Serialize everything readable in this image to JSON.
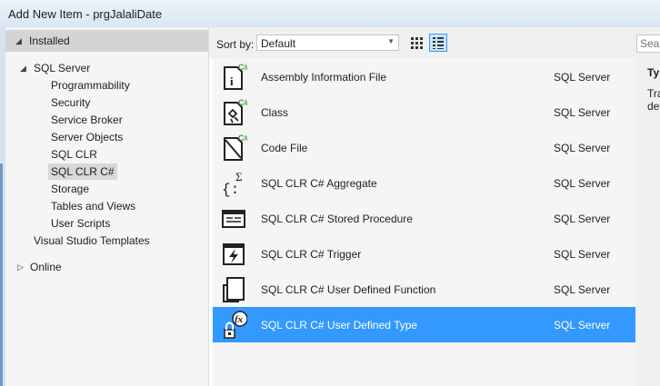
{
  "window": {
    "title": "Add New Item - prgJalaliDate"
  },
  "left_pane": {
    "installed_label": "Installed",
    "tree": {
      "sql_server": "SQL Server",
      "children": [
        "Programmability",
        "Security",
        "Service Broker",
        "Server Objects",
        "SQL CLR",
        "SQL CLR C#",
        "Storage",
        "Tables and Views",
        "User Scripts"
      ],
      "selected_child": "SQL CLR C#",
      "vs_templates": "Visual Studio Templates",
      "online": "Online"
    }
  },
  "sort_bar": {
    "label": "Sort by:",
    "selected": "Default"
  },
  "items": [
    {
      "name": "Assembly Information File",
      "category": "SQL Server",
      "icon": "assembly-info-icon"
    },
    {
      "name": "Class",
      "category": "SQL Server",
      "icon": "class-icon"
    },
    {
      "name": "Code File",
      "category": "SQL Server",
      "icon": "code-file-icon"
    },
    {
      "name": "SQL CLR C# Aggregate",
      "category": "SQL Server",
      "icon": "aggregate-icon"
    },
    {
      "name": "SQL CLR C# Stored Procedure",
      "category": "SQL Server",
      "icon": "stored-procedure-icon"
    },
    {
      "name": "SQL CLR C# Trigger",
      "category": "SQL Server",
      "icon": "trigger-icon"
    },
    {
      "name": "SQL CLR C# User Defined Function",
      "category": "SQL Server",
      "icon": "user-defined-function-icon"
    },
    {
      "name": "SQL CLR C# User Defined Type",
      "category": "SQL Server",
      "icon": "user-defined-type-icon",
      "selected": true
    }
  ],
  "right_pane": {
    "search_placeholder": "Search Installed Templates",
    "type_heading": "Type:",
    "description": [
      "Tra",
      "def"
    ]
  },
  "colors": {
    "selection": "#3399ff",
    "accent_green": "#3a9a3a"
  }
}
